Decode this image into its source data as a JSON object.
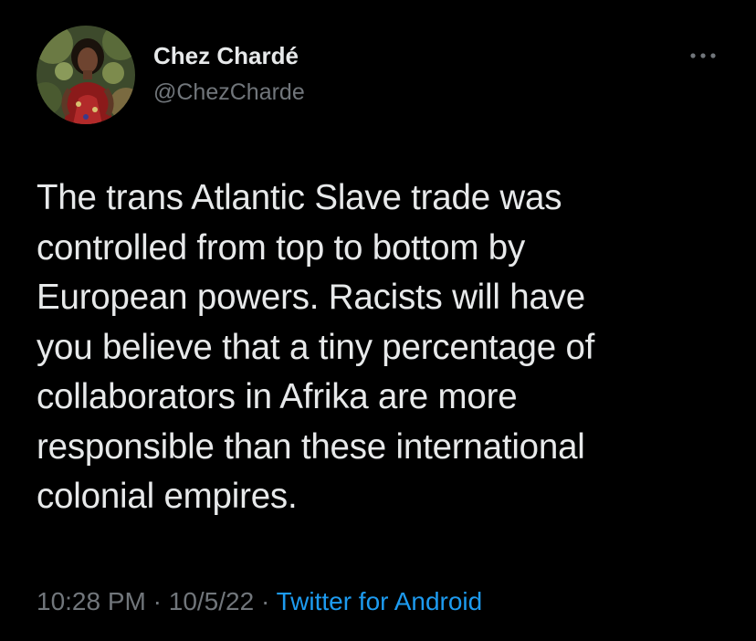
{
  "user": {
    "display_name": "Chez Chardé",
    "handle": "@ChezCharde",
    "avatar_icon": "profile-photo"
  },
  "tweet": {
    "text": "The trans Atlantic Slave trade was\ncontrolled from top to bottom by\nEuropean powers. Racists will have\nyou believe that a tiny percentage of\ncollaborators in Afrika are more\nresponsible than these international\ncolonial empires.",
    "time": "10:28 PM",
    "sep1": " · ",
    "date": "10/5/22",
    "sep2": " · ",
    "source": "Twitter for Android"
  },
  "menu": {
    "icon": "more-horizontal-icon"
  },
  "colors": {
    "background": "#000000",
    "text_primary": "#e7e9ea",
    "text_secondary": "#71767b",
    "link": "#1d9bf0"
  }
}
